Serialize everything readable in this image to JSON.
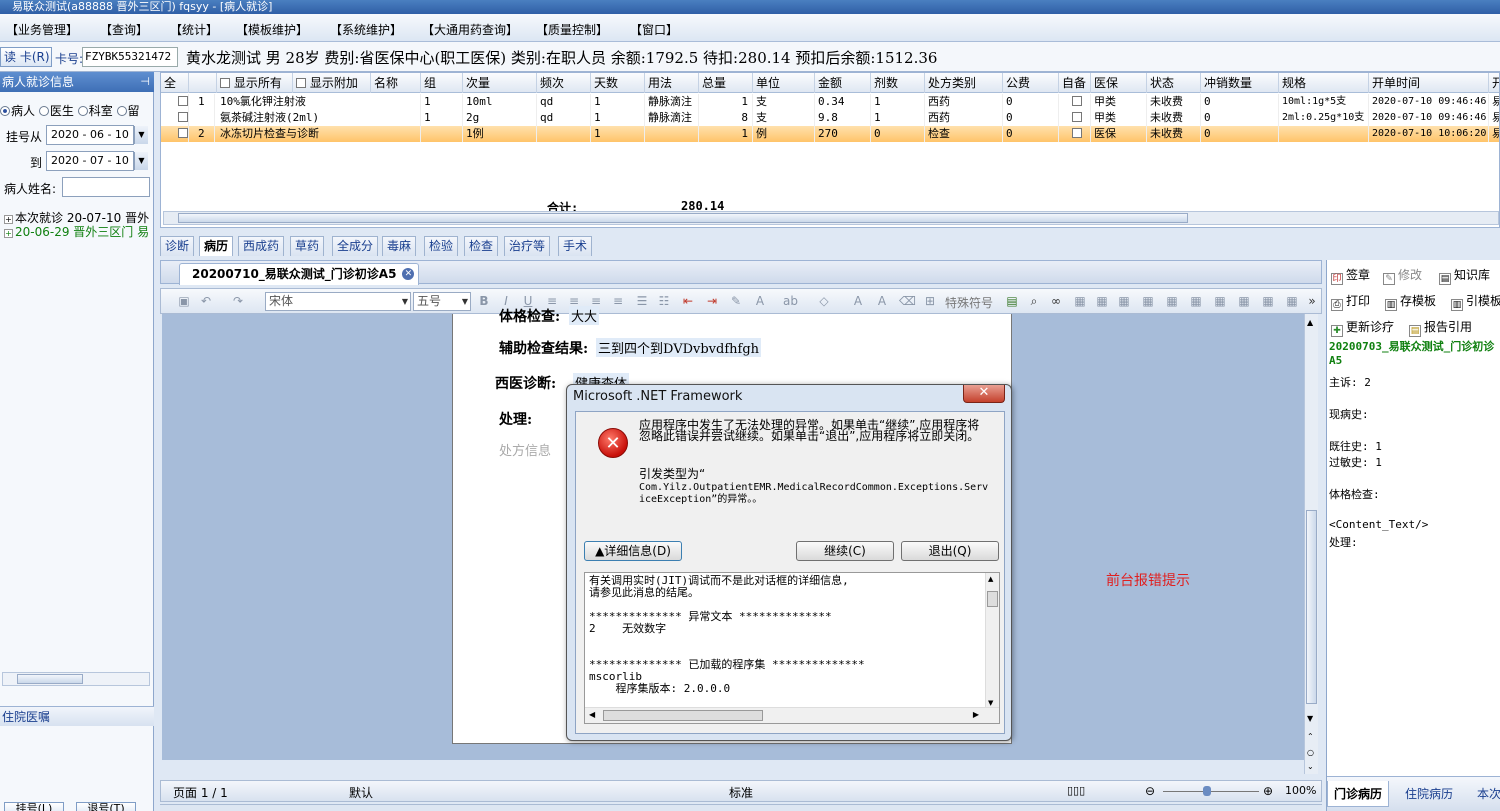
{
  "window": {
    "title": "易联众测试(a88888 晋外三区门)  fqsyy - [病人就诊]"
  },
  "menu": [
    "【业务管理】",
    "【查询】",
    "【统计】",
    "【模板维护】",
    "【系统维护】",
    "【大通用药查询】",
    "【质量控制】",
    "【窗口】"
  ],
  "patient_bar": {
    "read_card": "读 卡(R)",
    "card_label": "卡号:",
    "card_no": "FZYBK55321472",
    "info": "黄水龙测试 男 28岁 费别:省医保中心(职工医保) 类别:在职人员 余额:1792.5 待扣:280.14 预扣后余额:1512.36"
  },
  "left_panel": {
    "header": "病人就诊信息",
    "radios": [
      "病人",
      "医生",
      "科室",
      "留"
    ],
    "reg_from_label": "挂号从",
    "reg_from": "2020 - 06 - 10",
    "reg_to_label": "到",
    "reg_to": "2020 - 07 - 10",
    "name_label": "病人姓名:",
    "tree": [
      {
        "text": "本次就诊 20-07-10 晋外",
        "color": "#000000"
      },
      {
        "text": "20-06-29 晋外三区门 易",
        "color": "#108010"
      }
    ],
    "inpatient_header": "住院医嘱",
    "bottom_buttons": [
      "挂号(L)",
      "退号(T)"
    ]
  },
  "grid": {
    "headers": [
      "全",
      "",
      "显示所有",
      "显示附加",
      "名称",
      "组",
      "次量",
      "频次",
      "天数",
      "用法",
      "总量",
      "单位",
      "金额",
      "剂数",
      "处方类别",
      "公费",
      "自备",
      "医保",
      "状态",
      "冲销数量",
      "规格",
      "开单时间",
      "开"
    ],
    "rows": [
      {
        "no": "1",
        "name": "10%氯化钾注射液",
        "group": "1",
        "dose": "10ml",
        "freq": "qd",
        "days": "1",
        "usage": "静脉滴注",
        "total": "1",
        "unit": "支",
        "amount": "0.34",
        "doses": "1",
        "rx_type": "西药",
        "public": "0",
        "insurance": "甲类",
        "status": "未收费",
        "offset": "0",
        "spec": "10ml:1g*5支",
        "time": "2020-07-10 09:46:46",
        "extra": "易"
      },
      {
        "no": "",
        "name": "氨茶碱注射液(2ml)",
        "group": "1",
        "dose": "2g",
        "freq": "qd",
        "days": "1",
        "usage": "静脉滴注",
        "total": "8",
        "unit": "支",
        "amount": "9.8",
        "doses": "1",
        "rx_type": "西药",
        "public": "0",
        "insurance": "甲类",
        "status": "未收费",
        "offset": "0",
        "spec": "2ml:0.25g*10支",
        "time": "2020-07-10 09:46:46",
        "extra": "易"
      },
      {
        "no": "2",
        "name": "冰冻切片检查与诊断",
        "group": "",
        "dose": "1例",
        "freq": "",
        "days": "1",
        "usage": "",
        "total": "1",
        "unit": "例",
        "amount": "270",
        "doses": "0",
        "rx_type": "检查",
        "public": "0",
        "insurance": "医保",
        "status": "未收费",
        "offset": "0",
        "spec": "",
        "time": "2020-07-10 10:06:20",
        "extra": "易"
      }
    ],
    "sum_label": "合计:",
    "sum_value": "280.14"
  },
  "tabs": [
    "诊断",
    "病历",
    "西成药",
    "草药",
    "全成分",
    "毒麻",
    "检验",
    "检查",
    "治疗等",
    "手术"
  ],
  "active_tab": "病历",
  "doc_tab": "20200710_易联众测试_门诊初诊A5",
  "toolbar": {
    "font": "宋体",
    "size": "五号",
    "special_symbol": "特殊符号"
  },
  "document": {
    "exam_label": "体格检查:",
    "exam_value": "大大",
    "aux_label": "辅助检查结果:",
    "aux_value": "三到四个到DVDvbvdfhfgh",
    "diag_label": "西医诊断:",
    "diag_value": "健康查体",
    "treat_label": "处理:",
    "rx_info": "处方信息"
  },
  "statusbar": {
    "page": "页面 1 / 1",
    "style": "默认",
    "mode": "标准",
    "zoom": "100%"
  },
  "right_panel": {
    "buttons_row1": [
      "签章",
      "修改",
      "知识库"
    ],
    "buttons_row2": [
      "打印",
      "存模板",
      "引模板"
    ],
    "buttons_row3": [
      "更新诊疗",
      "报告引用"
    ],
    "record_title": "20200703_易联众测试_门诊初诊A5",
    "fields": [
      "主诉: 2",
      "现病史:",
      "既往史: 1",
      "过敏史: 1",
      "体格检查:",
      "<Content_Text/>",
      "处理:"
    ],
    "tabs": [
      "门诊病历",
      "住院病历",
      "本次"
    ]
  },
  "error_hint": "前台报错提示",
  "dialog": {
    "title": "Microsoft .NET Framework",
    "message": "应用程序中发生了无法处理的异常。如果单击“继续”,应用程序将忽略此错误并尝试继续。如果单击“退出”,应用程序将立即关闭。",
    "exception_label": "引发类型为“",
    "exception_type": "Com.Yilz.OutpatientEMR.MedicalRecordCommon.Exceptions.ServiceException”的异常。。",
    "btn_detail": "▲详细信息(D)",
    "btn_continue": "继续(C)",
    "btn_quit": "退出(Q)",
    "detail_text": "有关调用实时(JIT)调试而不是此对话框的详细信息,\n请参见此消息的结尾。\n\n************** 异常文本 **************\n2    无效数字\n\n\n************** 已加载的程序集 **************\nmscorlib\n    程序集版本: 2.0.0.0"
  }
}
